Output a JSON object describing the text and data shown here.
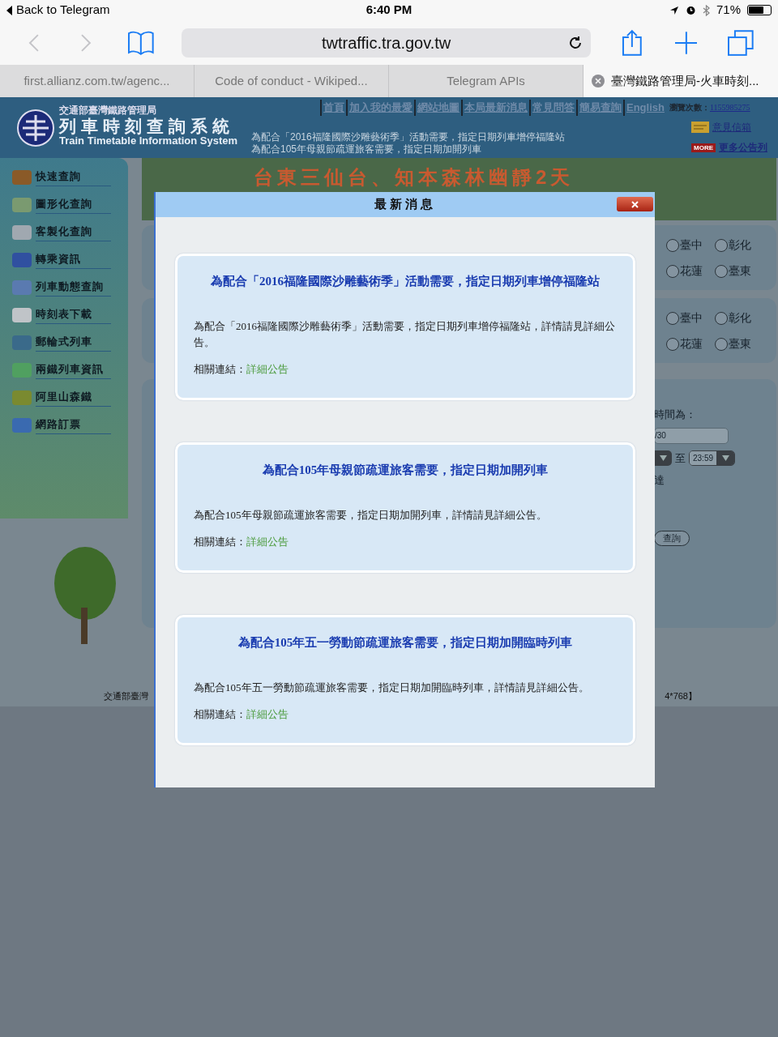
{
  "status_bar": {
    "back_label": "Back to Telegram",
    "time": "6:40 PM",
    "battery": "71%"
  },
  "toolbar": {
    "address": "twtraffic.tra.gov.tw"
  },
  "tabs": [
    {
      "label": "first.allianz.com.tw/agenc...",
      "selected": false
    },
    {
      "label": "Code of conduct - Wikiped...",
      "selected": false
    },
    {
      "label": "Telegram APIs",
      "selected": false
    },
    {
      "label": "臺灣鐵路管理局-火車時刻...",
      "selected": true
    }
  ],
  "site_header": {
    "org": "交通部臺灣鐵路管理局",
    "title": "列車時刻查詢系統",
    "subtitle": "Train Timetable Information System",
    "nav_links": [
      "首頁",
      "加入我的最愛",
      "網站地圖",
      "本局最新消息",
      "常見問答",
      "簡易查詢",
      "English"
    ],
    "visit_count_label": "瀏覽次數：",
    "visit_count": "1155985275",
    "ticker": [
      "為配合「2016福隆國際沙雕藝術季」活動需要，指定日期列車增停福隆站",
      "為配合105年母親節疏運旅客需要，指定日期加開列車"
    ],
    "mailbox_link": "意見信箱",
    "more_badge": "MORE",
    "more_link": "更多公告列"
  },
  "banner": {
    "title": "台東三仙台、知本森林幽靜2天"
  },
  "sidebar": {
    "items": [
      {
        "label": "快速查詢"
      },
      {
        "label": "圖形化查詢"
      },
      {
        "label": "客製化查詢"
      },
      {
        "label": "轉乘資訊"
      },
      {
        "label": "列車動態查詢"
      },
      {
        "label": "時刻表下載"
      },
      {
        "label": "郵輪式列車"
      },
      {
        "label": "兩鐵列車資訊"
      },
      {
        "label": "阿里山森鐵"
      },
      {
        "label": "網路訂票"
      }
    ]
  },
  "form": {
    "panels": [
      {
        "radios": [
          {
            "label": "臺中",
            "selected": false
          },
          {
            "label": "彰化",
            "selected": false
          },
          {
            "label": "花蓮",
            "selected": false
          },
          {
            "label": "臺東",
            "selected": false
          }
        ]
      },
      {
        "radios": [
          {
            "label": "臺中",
            "selected": false
          },
          {
            "label": "彰化",
            "selected": false
          },
          {
            "label": "花蓮",
            "selected": false
          },
          {
            "label": "臺東",
            "selected": false
          }
        ]
      }
    ],
    "time_label": "時間為：",
    "date_value": "/30",
    "to_label": "至",
    "end_time": "23:59",
    "arrive_label": "達",
    "search_button": "查詢"
  },
  "footer": {
    "left": "交通部臺灣",
    "right": "4*768】"
  },
  "modal": {
    "title": "最新消息",
    "news": [
      {
        "title": "為配合「2016福隆國際沙雕藝術季」活動需要，指定日期列車增停福隆站",
        "body": "為配合「2016福隆國際沙雕藝術季」活動需要，指定日期列車增停福隆站，詳情請見詳細公告。",
        "link_label": "相關連結：",
        "link": "詳細公告"
      },
      {
        "title": "為配合105年母親節疏運旅客需要，指定日期加開列車",
        "body": "為配合105年母親節疏運旅客需要，指定日期加開列車，詳情請見詳細公告。",
        "link_label": "相關連結：",
        "link": "詳細公告"
      },
      {
        "title": "為配合105年五一勞動節疏運旅客需要，指定日期加開臨時列車",
        "body": "為配合105年五一勞動節疏運旅客需要，指定日期加開臨時列車，詳情請見詳細公告。",
        "link_label": "相關連結：",
        "link": "詳細公告"
      }
    ]
  }
}
